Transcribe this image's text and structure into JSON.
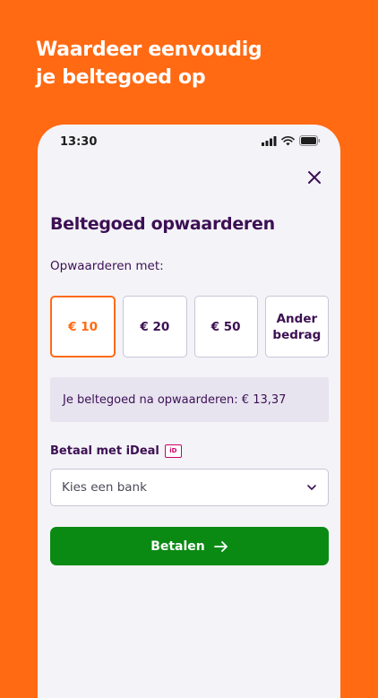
{
  "headline": {
    "line1": "Waardeer eenvoudig",
    "line2": "je beltegoed op"
  },
  "status": {
    "time": "13:30"
  },
  "page": {
    "title": "Beltegoed opwaarderen",
    "subtitle": "Opwaarderen met:"
  },
  "amounts": [
    {
      "label": "€ 10",
      "selected": true
    },
    {
      "label": "€ 20"
    },
    {
      "label": "€ 50"
    },
    {
      "label_line1": "Ander",
      "label_line2": "bedrag"
    }
  ],
  "balance_text": "Je beltegoed na opwaarderen: € 13,37",
  "ideal": {
    "label": "Betaal met iDeal",
    "logo_text": "iD"
  },
  "bank_select": {
    "value": "Kies een bank"
  },
  "pay_button": {
    "label": "Betalen"
  },
  "colors": {
    "accent": "#FF6A13",
    "primary_text": "#3C1053",
    "pay": "#0A8A13",
    "ideal_logo": "#CC0066"
  }
}
